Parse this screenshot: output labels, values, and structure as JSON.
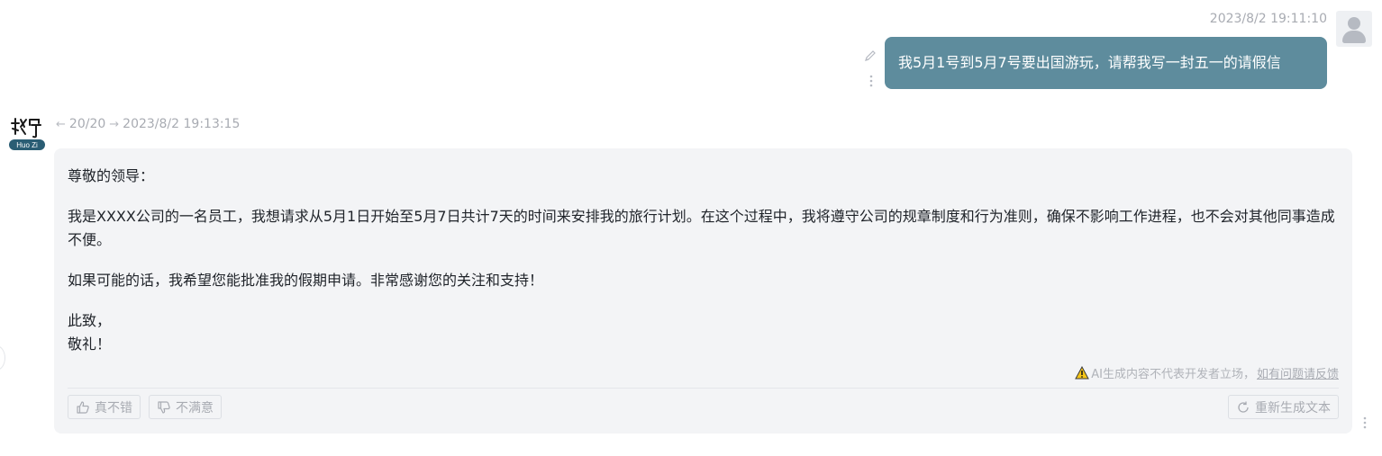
{
  "user_message": {
    "timestamp": "2023/8/2 19:11:10",
    "text": "我5月1号到5月7号要出国游玩，请帮我写一封五一的请假信",
    "bubble_color": "#5e8c9d"
  },
  "bot_message": {
    "logo_text": "Huo Zi",
    "page_indicator": "20/20",
    "timestamp": "2023/8/2 19:13:15",
    "salutation": "尊敬的领导：",
    "paragraph_1": "我是XXXX公司的一名员工，我想请求从5月1日开始至5月7日共计7天的时间来安排我的旅行计划。在这个过程中，我将遵守公司的规章制度和行为准则，确保不影响工作进程，也不会对其他同事造成不便。",
    "paragraph_2": "如果可能的话，我希望您能批准我的假期申请。非常感谢您的关注和支持！",
    "closing_1": "此致，",
    "closing_2": "敬礼！",
    "disclaimer": "AI生成内容不代表开发者立场，",
    "feedback_link": "如有问题请反馈",
    "like_label": "真不错",
    "dislike_label": "不满意",
    "regenerate_label": "重新生成文本",
    "card_color": "#f3f4f6",
    "warning_color": "#f5c518"
  },
  "icons": {
    "user_avatar": "user-avatar-icon",
    "edit": "pencil-icon",
    "more": "vertical-dots-icon",
    "prev": "arrow-left-icon",
    "next": "arrow-right-icon",
    "warning": "warning-triangle-icon",
    "like": "thumbs-up-icon",
    "dislike": "thumbs-down-icon",
    "regenerate": "refresh-icon"
  }
}
